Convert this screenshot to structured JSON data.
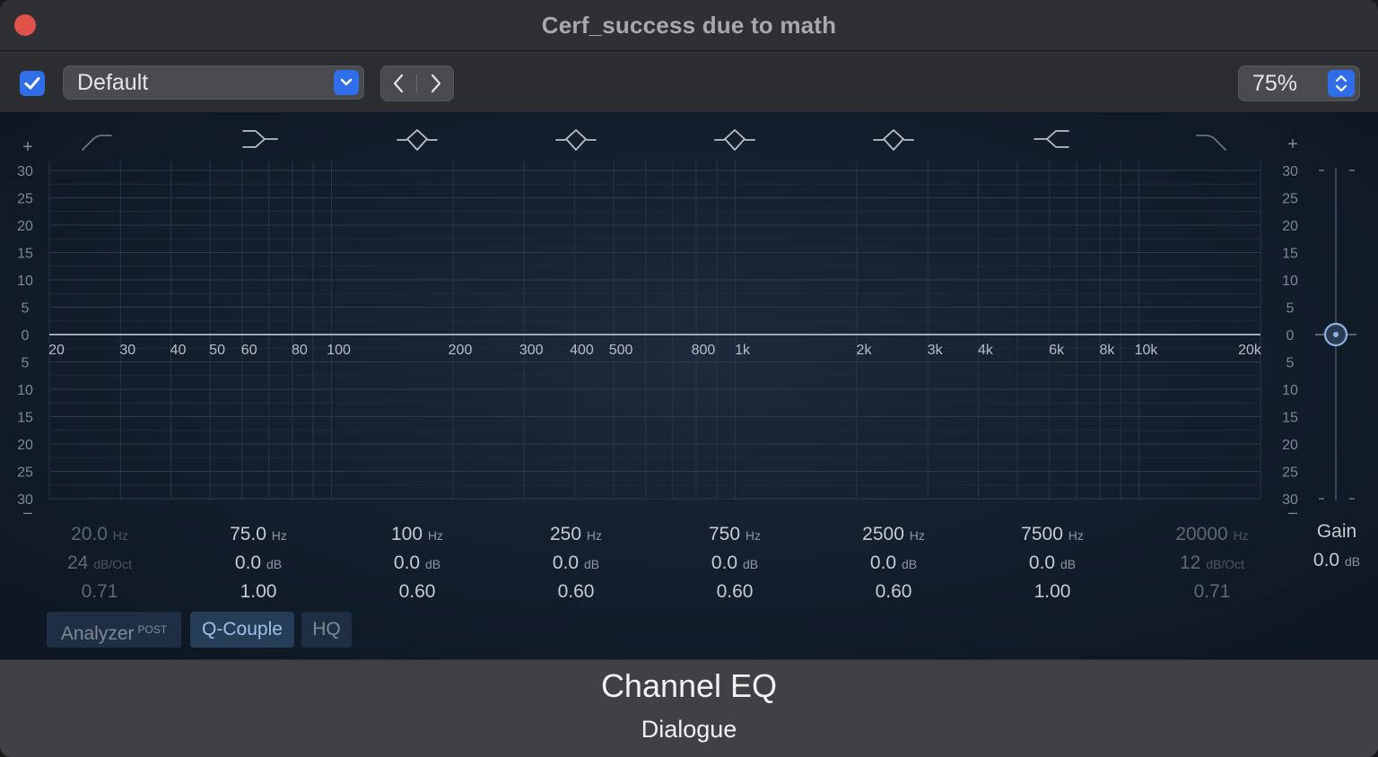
{
  "window": {
    "title": "Cerf_success due to math"
  },
  "toolbar": {
    "preset": "Default",
    "zoom": "75%",
    "colors": {
      "accent": "#2f6ee8"
    }
  },
  "graph": {
    "left_scale": [
      "30",
      "25",
      "20",
      "15",
      "10",
      "5",
      "0",
      "5",
      "10",
      "15",
      "20",
      "25",
      "30"
    ],
    "right_scale": [
      "30",
      "25",
      "20",
      "15",
      "10",
      "5",
      "0",
      "5",
      "10",
      "15",
      "20",
      "25",
      "30"
    ],
    "plus_symbol": "+",
    "minus_symbol": "–",
    "freq_labels": [
      "20",
      "30",
      "40",
      "50",
      "60",
      "80",
      "100",
      "200",
      "300",
      "400",
      "500",
      "800",
      "1k",
      "2k",
      "3k",
      "4k",
      "6k",
      "8k",
      "10k",
      "20k"
    ],
    "freq_values": [
      20,
      30,
      40,
      50,
      60,
      80,
      100,
      200,
      300,
      400,
      500,
      800,
      1000,
      2000,
      3000,
      4000,
      6000,
      8000,
      10000,
      20000
    ]
  },
  "bands": [
    {
      "icon": "low-cut-icon",
      "freq": "20.0",
      "freq_unit": "Hz",
      "gain": "24",
      "gain_unit": "dB/Oct",
      "q": "0.71",
      "active": false
    },
    {
      "icon": "low-shelf-icon",
      "freq": "75.0",
      "freq_unit": "Hz",
      "gain": "0.0",
      "gain_unit": "dB",
      "q": "1.00",
      "active": true
    },
    {
      "icon": "parametric-icon",
      "freq": "100",
      "freq_unit": "Hz",
      "gain": "0.0",
      "gain_unit": "dB",
      "q": "0.60",
      "active": true
    },
    {
      "icon": "parametric-icon",
      "freq": "250",
      "freq_unit": "Hz",
      "gain": "0.0",
      "gain_unit": "dB",
      "q": "0.60",
      "active": true
    },
    {
      "icon": "parametric-icon",
      "freq": "750",
      "freq_unit": "Hz",
      "gain": "0.0",
      "gain_unit": "dB",
      "q": "0.60",
      "active": true
    },
    {
      "icon": "parametric-icon",
      "freq": "2500",
      "freq_unit": "Hz",
      "gain": "0.0",
      "gain_unit": "dB",
      "q": "0.60",
      "active": true
    },
    {
      "icon": "high-shelf-icon",
      "freq": "7500",
      "freq_unit": "Hz",
      "gain": "0.0",
      "gain_unit": "dB",
      "q": "1.00",
      "active": true
    },
    {
      "icon": "high-cut-icon",
      "freq": "20000",
      "freq_unit": "Hz",
      "gain": "12",
      "gain_unit": "dB/Oct",
      "q": "0.71",
      "active": false
    }
  ],
  "master_gain": {
    "label": "Gain",
    "value": "0.0",
    "unit": "dB",
    "db": 0
  },
  "buttons": {
    "analyzer": "Analyzer",
    "analyzer_sup": "POST",
    "q_couple": "Q-Couple",
    "hq": "HQ"
  },
  "footer": {
    "plugin_name": "Channel EQ",
    "track_name": "Dialogue"
  }
}
